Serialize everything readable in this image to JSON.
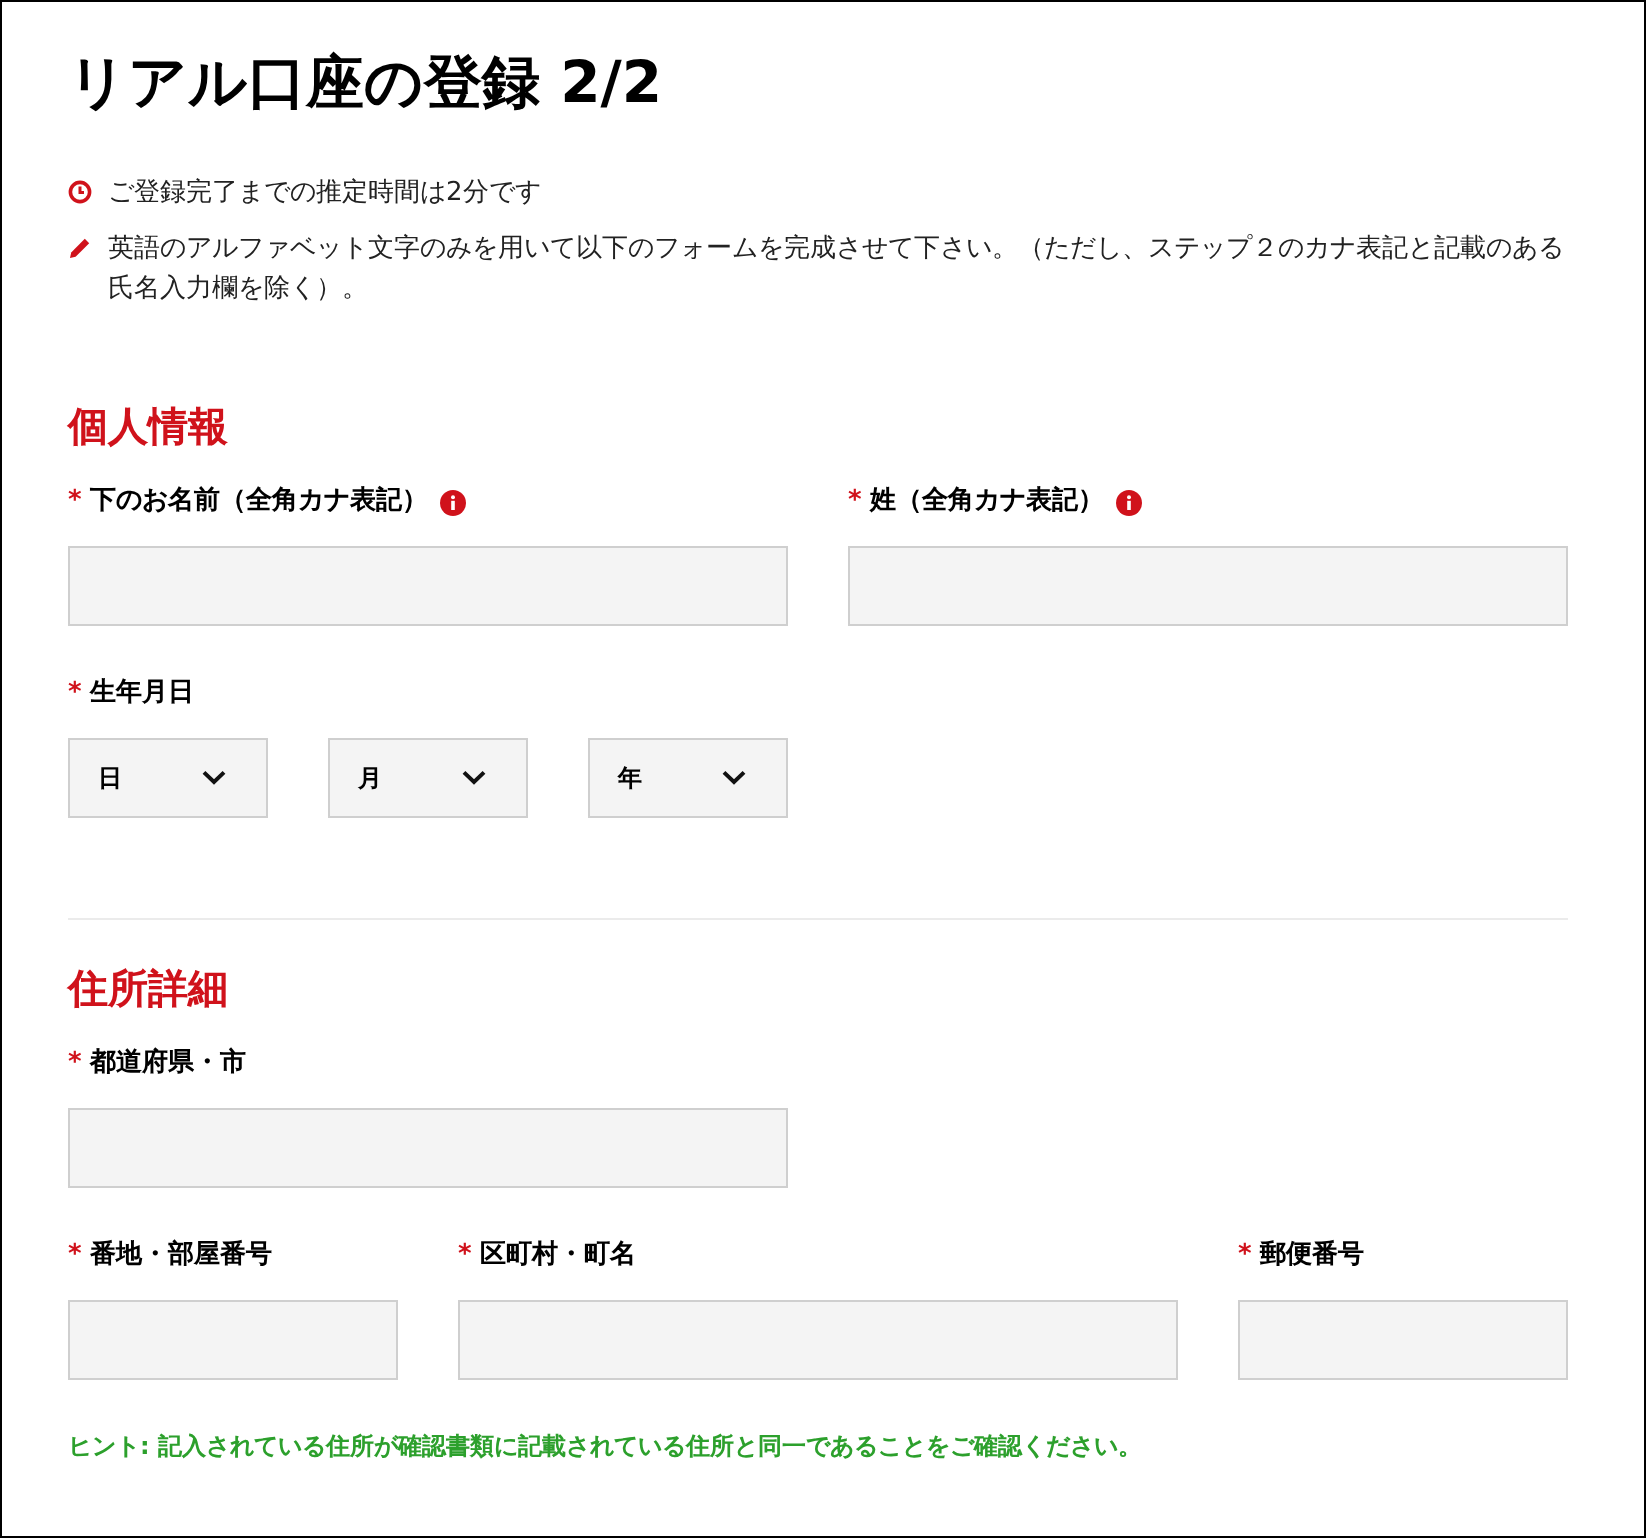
{
  "title": "リアル口座の登録 2/2",
  "notes": [
    {
      "kind": "time",
      "text": "ご登録完了までの推定時間は2分です"
    },
    {
      "kind": "edit",
      "text": "英語のアルファベット文字のみを用いて以下のフォームを完成させて下さい。（ただし、ステップ２のカナ表記と記載のある氏名入力欄を除く）。"
    }
  ],
  "sections": [
    {
      "heading": "個人情報",
      "rows": [
        {
          "fields": [
            {
              "kind": "text",
              "required_mark": "*",
              "label": "下のお名前（全角カナ表記）",
              "info": true
            },
            {
              "kind": "text",
              "required_mark": "*",
              "label": "姓（全角カナ表記）",
              "info": true
            }
          ]
        },
        {
          "fields": [
            {
              "kind": "date",
              "required_mark": "*",
              "label": "生年月日",
              "selects": [
                "日",
                "月",
                "年"
              ]
            }
          ]
        }
      ]
    },
    {
      "heading": "住所詳細",
      "rows": [
        {
          "fields": [
            {
              "kind": "text",
              "required_mark": "*",
              "label": "都道府県・市",
              "info": false
            }
          ]
        },
        {
          "fields": [
            {
              "kind": "short",
              "required_mark": "*",
              "label": "番地・部屋番号",
              "info": false
            },
            {
              "kind": "text",
              "required_mark": "*",
              "label": "区町村・町名",
              "info": false
            },
            {
              "kind": "short",
              "required_mark": "*",
              "label": "郵便番号",
              "info": false
            }
          ]
        }
      ]
    }
  ],
  "hint": "ヒント: 記入されている住所が確認書類に記載されている住所と同一であることをご確認ください。"
}
